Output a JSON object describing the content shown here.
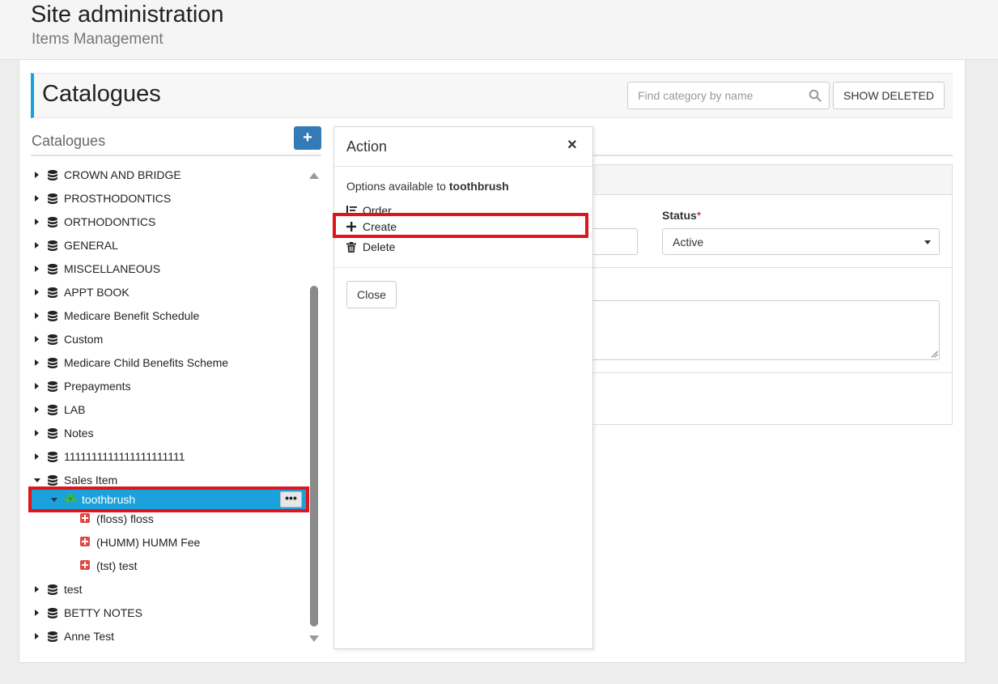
{
  "header": {
    "title": "Site administration",
    "subtitle": "Items Management"
  },
  "catalogues": {
    "title": "Catalogues",
    "search_placeholder": "Find category by name",
    "show_deleted_label": "SHOW DELETED",
    "left_heading": "Catalogues",
    "add_label": "+"
  },
  "tree": {
    "items": [
      {
        "label": "CROWN AND BRIDGE"
      },
      {
        "label": "PROSTHODONTICS"
      },
      {
        "label": "ORTHODONTICS"
      },
      {
        "label": "GENERAL"
      },
      {
        "label": "MISCELLANEOUS"
      },
      {
        "label": "APPT BOOK"
      },
      {
        "label": "Medicare Benefit Schedule"
      },
      {
        "label": "Custom"
      },
      {
        "label": "Medicare Child Benefits Scheme"
      },
      {
        "label": "Prepayments"
      },
      {
        "label": "LAB"
      },
      {
        "label": "Notes"
      },
      {
        "label": "1111111111111111111111"
      },
      {
        "label": "Sales Item"
      }
    ],
    "selected": {
      "label": "toothbrush",
      "menu_label": "•••"
    },
    "children": [
      {
        "label": "(floss) floss"
      },
      {
        "label": "(HUMM) HUMM Fee"
      },
      {
        "label": "(tst) test"
      }
    ],
    "after": [
      {
        "label": "test"
      },
      {
        "label": "BETTY NOTES"
      },
      {
        "label": "Anne Test"
      }
    ]
  },
  "form": {
    "status_label": "Status",
    "status_required": "*",
    "status_value": "Active"
  },
  "modal": {
    "title": "Action",
    "close_glyph": "×",
    "desc_prefix": "Options available to ",
    "desc_item": "toothbrush",
    "options": [
      {
        "label": "Order",
        "icon": "sort-icon"
      },
      {
        "label": "Create",
        "icon": "plus-icon"
      },
      {
        "label": "Delete",
        "icon": "trash-icon"
      }
    ],
    "close_button": "Close"
  },
  "colors": {
    "accent": "#1aa0dc",
    "selected": "#1ba1db",
    "highlight": "#e0151b",
    "primary_button": "#337ab7"
  }
}
